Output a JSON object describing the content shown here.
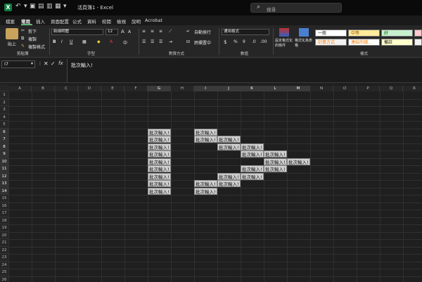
{
  "titlebar": {
    "title": "活頁簿1 - Excel",
    "search_placeholder": "搜尋"
  },
  "tabs": [
    "檔案",
    "常用",
    "插入",
    "頁面配置",
    "公式",
    "資料",
    "校閱",
    "檢視",
    "說明",
    "Acrobat"
  ],
  "ribbon": {
    "clipboard": {
      "paste": "貼上",
      "cut": "剪下",
      "copy": "複製",
      "format_painter": "複製格式",
      "label": "剪貼簿"
    },
    "font": {
      "name": "新細明體",
      "size": "12",
      "label": "字型"
    },
    "alignment": {
      "wrap": "自動換行",
      "merge": "跨欄置中",
      "label": "對齊方式"
    },
    "number": {
      "format": "通用格式",
      "label": "數值"
    },
    "styles": {
      "conditional": "設定格式化的條件",
      "table": "格式化為表格",
      "good": "好",
      "normal": "一般",
      "medium": "中等",
      "calc": "計算方式",
      "linked": "連結的儲...",
      "note": "備註",
      "label": "樣式"
    }
  },
  "formula": {
    "namebox": "I7",
    "fx_content": "批次輸入!"
  },
  "columns": [
    "A",
    "B",
    "C",
    "D",
    "E",
    "F",
    "G",
    "H",
    "I",
    "J",
    "K",
    "L",
    "M",
    "N",
    "O",
    "P",
    "Q",
    "R"
  ],
  "selected_columns": [
    "G",
    "I",
    "J",
    "K",
    "L",
    "M"
  ],
  "rows": [
    "1",
    "2",
    "3",
    "4",
    "5",
    "6",
    "7",
    "8",
    "9",
    "10",
    "11",
    "12",
    "13",
    "14",
    "15",
    "16",
    "17",
    "18",
    "19",
    "20",
    "21",
    "22",
    "23",
    "24",
    "25",
    "26"
  ],
  "selected_rows": [
    "6",
    "7",
    "8",
    "9",
    "10",
    "11",
    "12",
    "13",
    "14"
  ],
  "cell_text": "批次輸入!",
  "cells": [
    {
      "col": "G",
      "row": 6
    },
    {
      "col": "G",
      "row": 7
    },
    {
      "col": "G",
      "row": 8
    },
    {
      "col": "G",
      "row": 9
    },
    {
      "col": "G",
      "row": 10
    },
    {
      "col": "G",
      "row": 11
    },
    {
      "col": "G",
      "row": 12
    },
    {
      "col": "G",
      "row": 13
    },
    {
      "col": "G",
      "row": 14
    },
    {
      "col": "I",
      "row": 6
    },
    {
      "col": "I",
      "row": 7
    },
    {
      "col": "J",
      "row": 7
    },
    {
      "col": "J",
      "row": 8
    },
    {
      "col": "K",
      "row": 8
    },
    {
      "col": "K",
      "row": 9
    },
    {
      "col": "L",
      "row": 9
    },
    {
      "col": "L",
      "row": 10
    },
    {
      "col": "M",
      "row": 10
    },
    {
      "col": "L",
      "row": 11
    },
    {
      "col": "K",
      "row": 11
    },
    {
      "col": "K",
      "row": 12
    },
    {
      "col": "J",
      "row": 12
    },
    {
      "col": "J",
      "row": 13
    },
    {
      "col": "I",
      "row": 13
    },
    {
      "col": "I",
      "row": 14
    }
  ]
}
